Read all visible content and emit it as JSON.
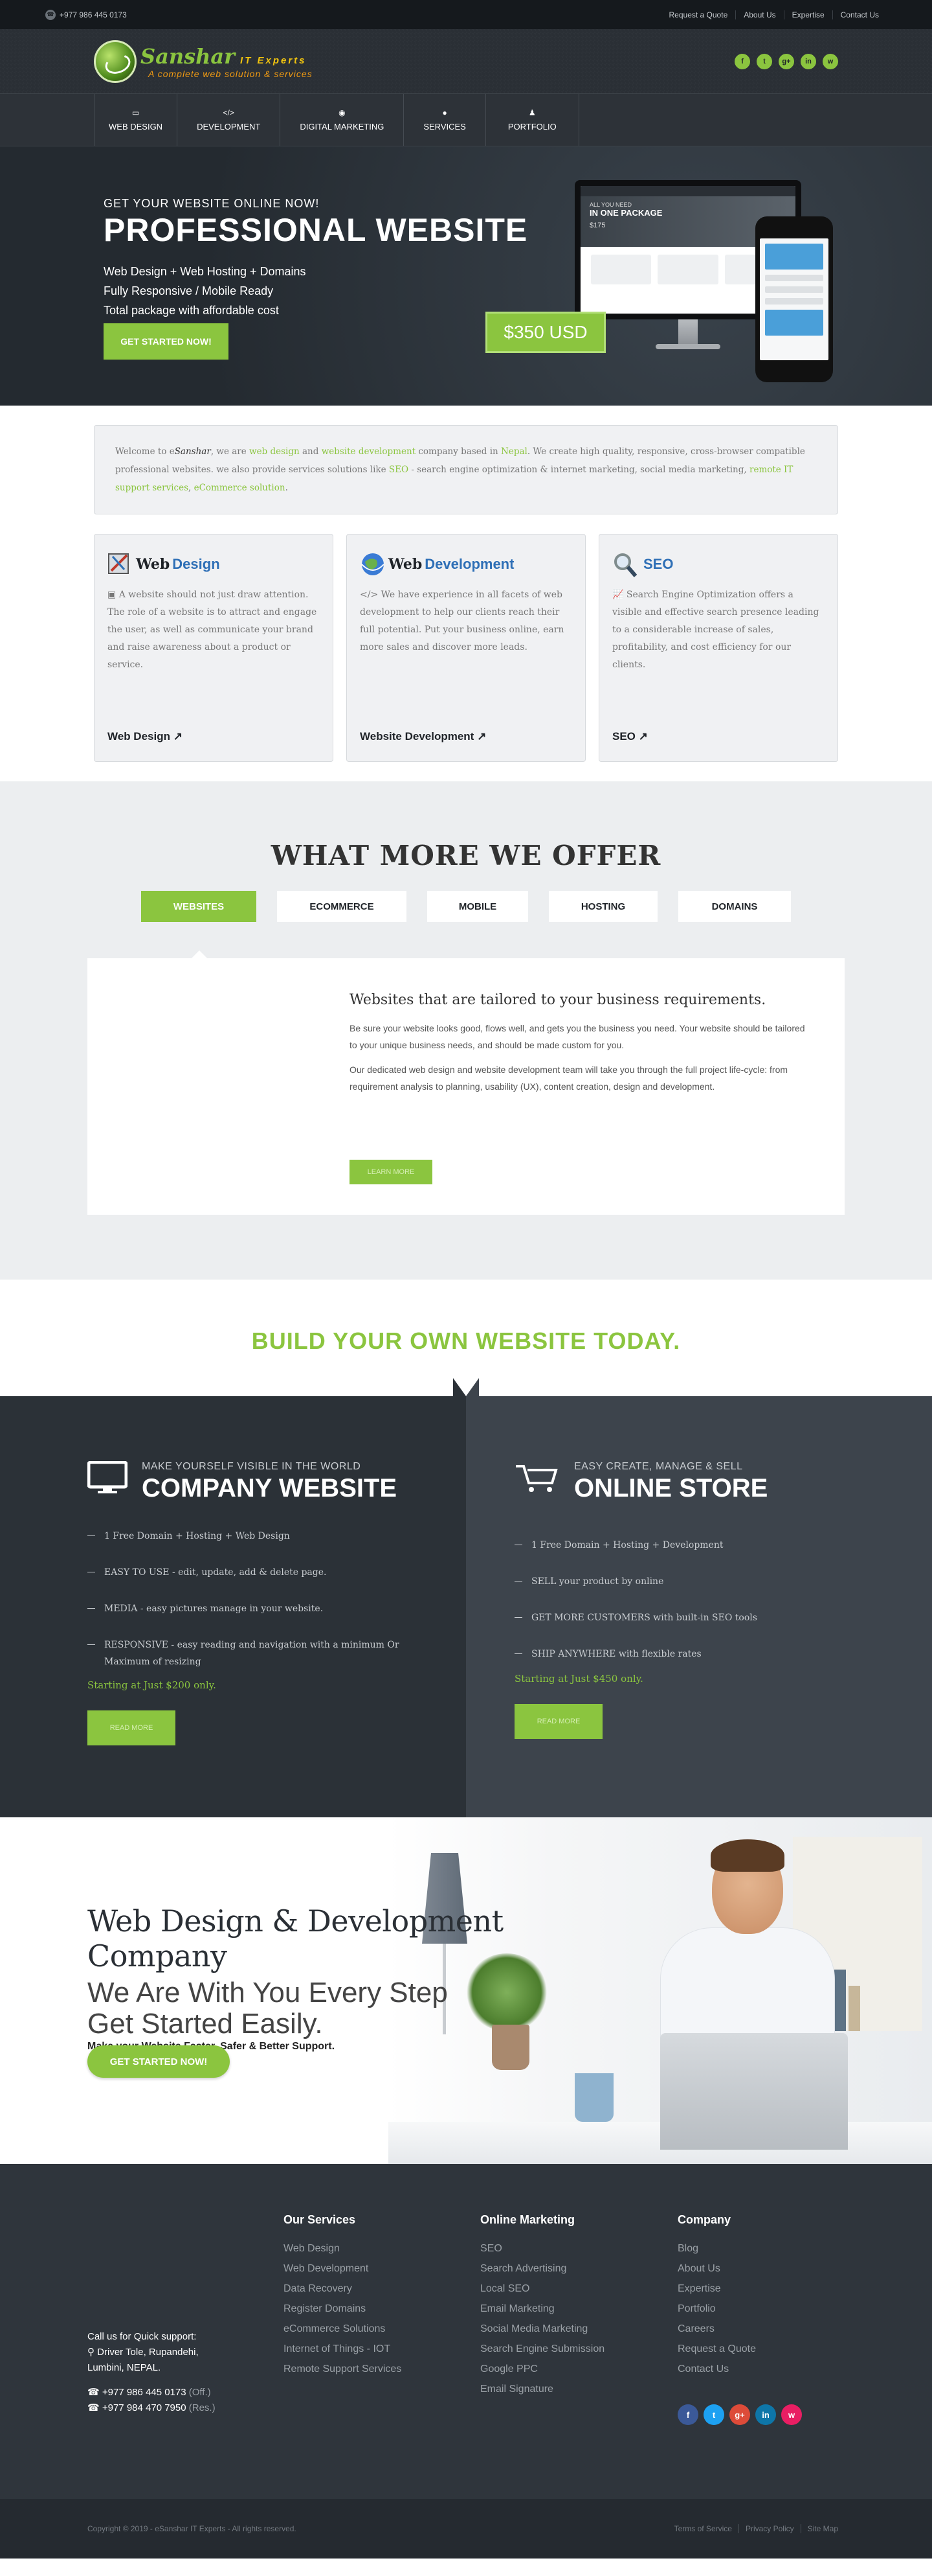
{
  "topbar": {
    "phone": "+977 986 445 0173",
    "links": [
      "Request a Quote",
      "About Us",
      "Expertise",
      "Contact Us"
    ]
  },
  "header": {
    "brand": "Sanshar",
    "tagline": "IT Experts",
    "slogan": "A complete web solution & services",
    "social": [
      "f",
      "t",
      "g+",
      "in",
      "w"
    ]
  },
  "nav": {
    "items": [
      {
        "label": "WEB DESIGN",
        "icon": "laptop-icon"
      },
      {
        "label": "DEVELOPMENT",
        "icon": "code-icon"
      },
      {
        "label": "DIGITAL MARKETING",
        "icon": "globe-icon"
      },
      {
        "label": "SERVICES",
        "icon": "chat-icon"
      },
      {
        "label": "PORTFOLIO",
        "icon": "user-icon"
      }
    ]
  },
  "hero": {
    "small": "GET YOUR WEBSITE ONLINE NOW!",
    "title": "PROFESSIONAL WEBSITE",
    "points": [
      "Web Design + Web Hosting + Domains",
      "Fully Responsive / Mobile Ready",
      "Total package with affordable cost"
    ],
    "cta": "GET STARTED NOW!",
    "price": "$350 USD",
    "screen_title": "ALL YOU NEED",
    "screen_subtitle": "IN ONE PACKAGE",
    "screen_price": "$175"
  },
  "intro": {
    "p1": "Welcome to e",
    "brand": "Sanshar",
    "p2": ", we are ",
    "l1": "web design",
    "p3": " and ",
    "l2": "website development",
    "p4": " company based in ",
    "l3": "Nepal",
    "p5": ". We create high quality, responsive, cross-browser compatible professional websites. we also provide services solutions like ",
    "l4": "SEO",
    "p6": " - search engine optimization & internet marketing, social media marketing, ",
    "l5": "remote IT support services",
    "p7": ", ",
    "l6": "eCommerce solution",
    "p8": "."
  },
  "services": [
    {
      "title_a": "Web",
      "title_b": "Design",
      "text": "A website should not just draw attention. The role of a website is to attract and engage the user, as well as communicate your brand and raise awareness about a product or service.",
      "link": "Web Design"
    },
    {
      "title_a": "Web",
      "title_b": "Development",
      "text": "We have experience in all facets of web development to help our clients reach their full potential. Put your business online, earn more sales and discover more leads.",
      "link": "Website Development"
    },
    {
      "title_a": "",
      "title_b": "SEO",
      "text": "Search Engine Optimization offers a visible and effective search presence leading to a considerable increase of sales, profitability, and cost efficiency for our clients.",
      "link": "SEO"
    }
  ],
  "offer": {
    "title": "WHAT MORE WE OFFER",
    "tabs": [
      "WEBSITES",
      "ECOMMERCE",
      "MOBILE",
      "HOSTING",
      "DOMAINS"
    ],
    "heading": "Websites that are tailored to your business requirements.",
    "p1": "Be sure your website looks good, flows well, and gets you the business you need. Your website should be tailored to your unique business needs, and should be made custom for you.",
    "p2": "Our dedicated web design and website development team will take you through the full project life-cycle: from requirement analysis to planning, usability (UX), content creation, design and development.",
    "button": "LEARN MORE"
  },
  "build": {
    "title": "BUILD YOUR OWN WEBSITE TODAY."
  },
  "plans": [
    {
      "sub": "MAKE YOURSELF VISIBLE IN THE WORLD",
      "title": "COMPANY WEBSITE",
      "icon": "monitor-icon",
      "items": [
        "1 Free Domain + Hosting + Web Design",
        "EASY TO USE - edit, update, add & delete page.",
        "MEDIA - easy pictures manage in your website.",
        "RESPONSIVE - easy reading and navigation with a minimum Or Maximum of resizing"
      ],
      "starting": "Starting at Just $200 only.",
      "button": "READ MORE"
    },
    {
      "sub": "EASY CREATE, MANAGE & SELL",
      "title": "ONLINE STORE",
      "icon": "cart-icon",
      "items": [
        "1 Free Domain + Hosting + Development",
        "SELL your product by online",
        "GET MORE CUSTOMERS with built-in SEO tools",
        "SHIP ANYWHERE with flexible rates"
      ],
      "starting": "Starting at Just $450 only.",
      "button": "READ MORE"
    }
  ],
  "company": {
    "title": "Web Design & Development Company",
    "line1": "We Are With You Every Step",
    "line2": "Get Started Easily.",
    "tagline": "Make your Website Faster, Safer & Better Support.",
    "cta": "GET STARTED NOW!"
  },
  "footer": {
    "cols": [
      {
        "title": "Our Services",
        "items": [
          "Web Design",
          "Web Development",
          "Data Recovery",
          "Register Domains",
          "eCommerce Solutions",
          "Internet of Things - IOT",
          "Remote Support Services"
        ]
      },
      {
        "title": "Online Marketing",
        "items": [
          "SEO",
          "Search Advertising",
          "Local SEO",
          "Email Marketing",
          "Social Media Marketing",
          "Search Engine Submission",
          "Google PPC",
          "Email Signature"
        ]
      },
      {
        "title": "Company",
        "items": [
          "Blog",
          "About Us",
          "Expertise",
          "Portfolio",
          "Careers",
          "Request a Quote",
          "Contact Us"
        ]
      }
    ],
    "support": "Call us for Quick support:",
    "addr1": "Driver Tole, Rupandehi,",
    "addr2": "Lumbini, NEPAL.",
    "phone1": "+977 986 445 0173",
    "phone1_note": "(Off.)",
    "phone2": "+977 984 470 7950",
    "phone2_note": "(Res.)",
    "social": [
      {
        "label": "f",
        "color": "#3b5998"
      },
      {
        "label": "t",
        "color": "#1da1f2"
      },
      {
        "label": "g+",
        "color": "#dd4b39"
      },
      {
        "label": "in",
        "color": "#0e76a8"
      },
      {
        "label": "w",
        "color": "#e91e63"
      }
    ],
    "copyright": "Copyright © 2019 - eSanshar IT Experts - All rights reserved.",
    "bottom_links": [
      "Terms of Service",
      "Privacy Policy",
      "Site Map"
    ]
  }
}
